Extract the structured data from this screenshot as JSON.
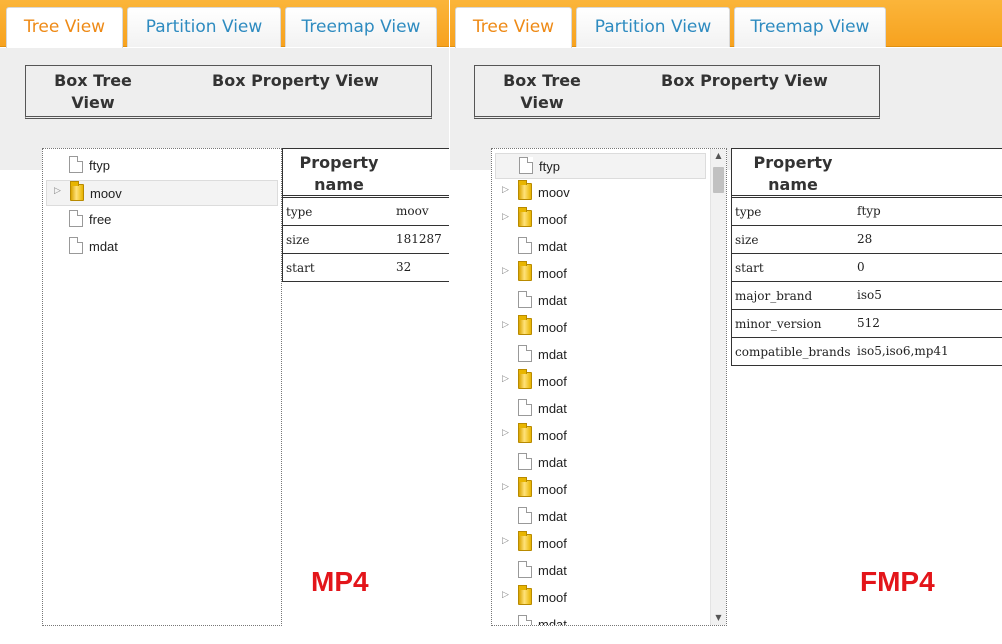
{
  "colors": {
    "tab_bar": "#f7a21f",
    "tab_active_text": "#ee8a16",
    "tab_text": "#2e8bc0",
    "caption": "#e3151a"
  },
  "panels": [
    {
      "tabs": [
        {
          "label": "Tree View",
          "active": true
        },
        {
          "label": "Partition View",
          "active": false
        },
        {
          "label": "Treemap View",
          "active": false
        }
      ],
      "header": {
        "tree_title_1": "Box Tree",
        "tree_title_2": "View",
        "property_title": "Box Property View"
      },
      "tree": [
        {
          "label": "ftyp",
          "icon": "file-icon",
          "expandable": false,
          "selected": false
        },
        {
          "label": "moov",
          "icon": "folder-icon",
          "expandable": true,
          "selected": true
        },
        {
          "label": "free",
          "icon": "file-icon",
          "expandable": false,
          "selected": false
        },
        {
          "label": "mdat",
          "icon": "file-icon",
          "expandable": false,
          "selected": false
        }
      ],
      "scrollbar": false,
      "properties": {
        "header_1": "Property",
        "header_2": "name",
        "rows": [
          {
            "key": "type",
            "value": "moov"
          },
          {
            "key": "size",
            "value": "181287"
          },
          {
            "key": "start",
            "value": "32"
          }
        ]
      },
      "caption": "MP4"
    },
    {
      "tabs": [
        {
          "label": "Tree View",
          "active": true
        },
        {
          "label": "Partition View",
          "active": false
        },
        {
          "label": "Treemap View",
          "active": false
        }
      ],
      "header": {
        "tree_title_1": "Box Tree",
        "tree_title_2": "View",
        "property_title": "Box Property View"
      },
      "tree": [
        {
          "label": "ftyp",
          "icon": "file-icon",
          "expandable": false,
          "selected": true
        },
        {
          "label": "moov",
          "icon": "folder-icon",
          "expandable": true,
          "selected": false
        },
        {
          "label": "moof",
          "icon": "folder-icon",
          "expandable": true,
          "selected": false
        },
        {
          "label": "mdat",
          "icon": "file-icon",
          "expandable": false,
          "selected": false
        },
        {
          "label": "moof",
          "icon": "folder-icon",
          "expandable": true,
          "selected": false
        },
        {
          "label": "mdat",
          "icon": "file-icon",
          "expandable": false,
          "selected": false
        },
        {
          "label": "moof",
          "icon": "folder-icon",
          "expandable": true,
          "selected": false
        },
        {
          "label": "mdat",
          "icon": "file-icon",
          "expandable": false,
          "selected": false
        },
        {
          "label": "moof",
          "icon": "folder-icon",
          "expandable": true,
          "selected": false
        },
        {
          "label": "mdat",
          "icon": "file-icon",
          "expandable": false,
          "selected": false
        },
        {
          "label": "moof",
          "icon": "folder-icon",
          "expandable": true,
          "selected": false
        },
        {
          "label": "mdat",
          "icon": "file-icon",
          "expandable": false,
          "selected": false
        },
        {
          "label": "moof",
          "icon": "folder-icon",
          "expandable": true,
          "selected": false
        },
        {
          "label": "mdat",
          "icon": "file-icon",
          "expandable": false,
          "selected": false
        },
        {
          "label": "moof",
          "icon": "folder-icon",
          "expandable": true,
          "selected": false
        },
        {
          "label": "mdat",
          "icon": "file-icon",
          "expandable": false,
          "selected": false
        },
        {
          "label": "moof",
          "icon": "folder-icon",
          "expandable": true,
          "selected": false
        },
        {
          "label": "mdat",
          "icon": "file-icon",
          "expandable": false,
          "selected": false
        }
      ],
      "scrollbar": true,
      "properties": {
        "header_1": "Property",
        "header_2": "name",
        "rows": [
          {
            "key": "type",
            "value": "ftyp"
          },
          {
            "key": "size",
            "value": "28"
          },
          {
            "key": "start",
            "value": "0"
          },
          {
            "key": "major_brand",
            "value": "iso5"
          },
          {
            "key": "minor_version",
            "value": "512"
          },
          {
            "key": "compatible_brands",
            "value": "iso5,iso6,mp41"
          }
        ]
      },
      "caption": "FMP4"
    }
  ]
}
